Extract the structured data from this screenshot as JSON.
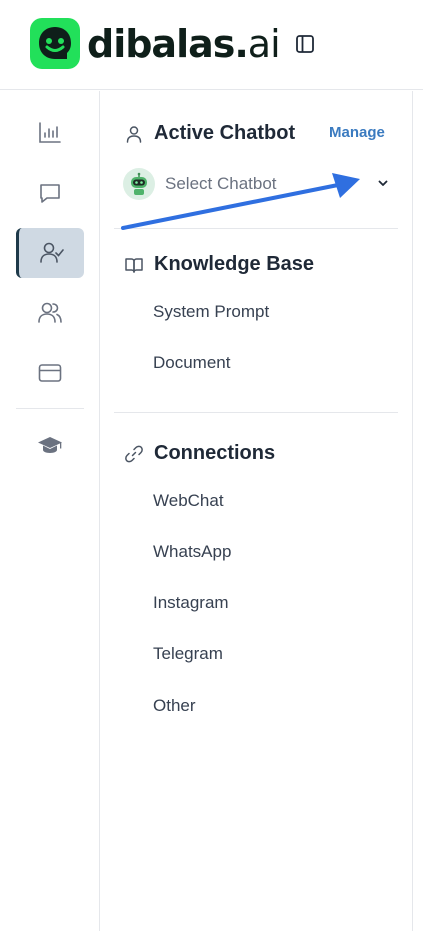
{
  "header": {
    "brand_main": "dibalas.",
    "brand_suffix": "ai",
    "brand_color": "#22e05a"
  },
  "rail": {
    "items": [
      {
        "icon": "bar-chart-icon",
        "active": false
      },
      {
        "icon": "chat-bubble-icon",
        "active": false
      },
      {
        "icon": "user-check-icon",
        "active": true
      },
      {
        "icon": "users-icon",
        "active": false
      },
      {
        "icon": "credit-card-icon",
        "active": false
      },
      {
        "icon": "graduation-cap-icon",
        "active": false
      }
    ]
  },
  "panel": {
    "active_chatbot": {
      "title": "Active Chatbot",
      "manage_label": "Manage",
      "select_placeholder": "Select Chatbot"
    },
    "knowledge_base": {
      "title": "Knowledge Base",
      "items": [
        "System Prompt",
        "Document"
      ]
    },
    "connections": {
      "title": "Connections",
      "items": [
        "WebChat",
        "WhatsApp",
        "Instagram",
        "Telegram",
        "Other"
      ]
    }
  },
  "colors": {
    "accent_link": "#3b7bc0",
    "active_rail_bg": "#cfd9e3",
    "annotation_arrow": "#2f6fe0"
  }
}
